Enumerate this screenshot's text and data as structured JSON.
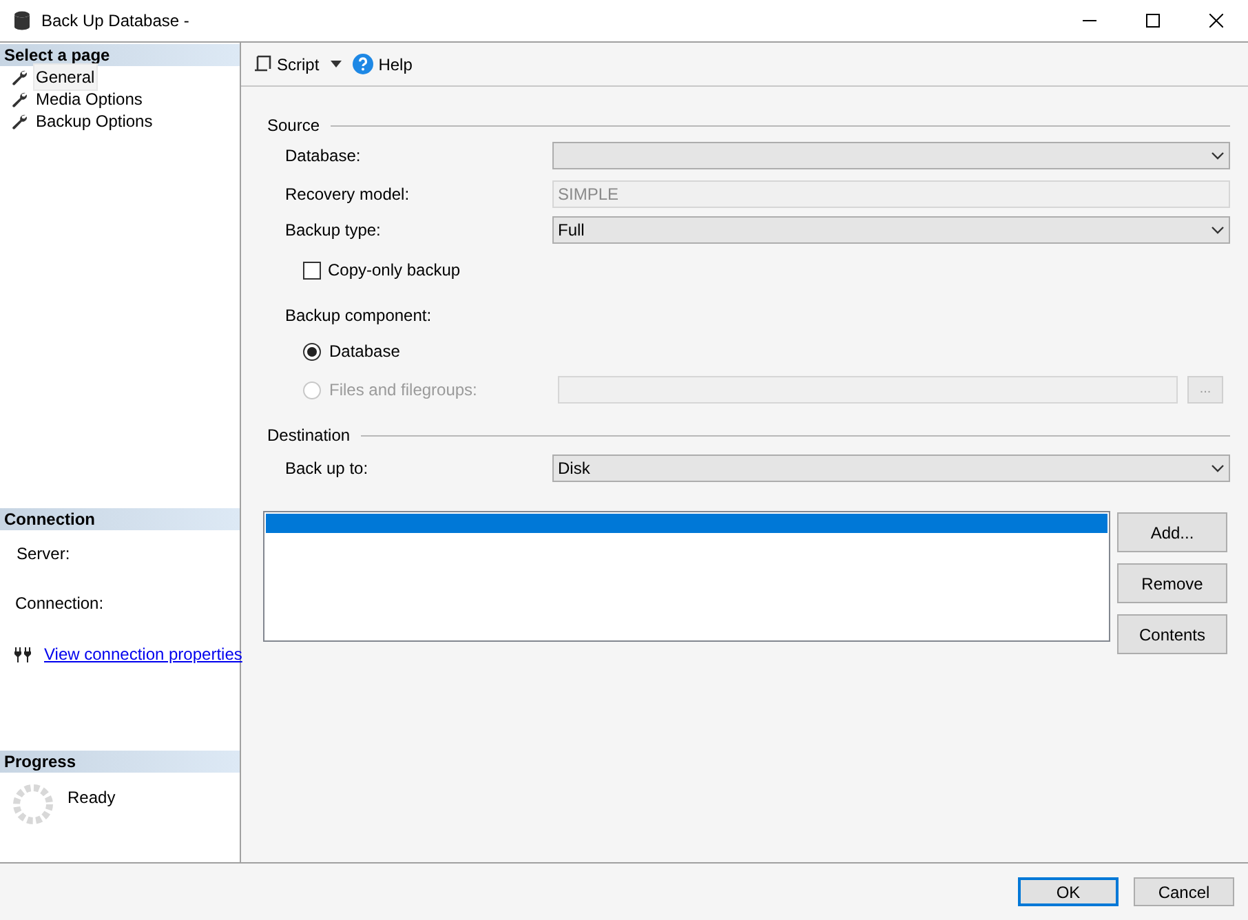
{
  "window": {
    "title": "Back Up Database -"
  },
  "sidebar": {
    "select_page": {
      "header": "Select a page",
      "items": [
        {
          "label": "General",
          "selected": true
        },
        {
          "label": "Media Options",
          "selected": false
        },
        {
          "label": "Backup Options",
          "selected": false
        }
      ]
    },
    "connection": {
      "header": "Connection",
      "fields": [
        "Server:",
        "Connection:"
      ],
      "link": "View connection properties"
    },
    "progress": {
      "header": "Progress",
      "status": "Ready"
    }
  },
  "toolbar": {
    "items": [
      {
        "kind": "script",
        "label": "Script"
      },
      {
        "kind": "help",
        "label": "Help"
      }
    ]
  },
  "source": {
    "title": "Source",
    "database": {
      "label": "Database:"
    },
    "recovery_model": {
      "label": "Recovery model:",
      "value": "SIMPLE"
    },
    "backup_type": {
      "label": "Backup type:",
      "value": "Full"
    },
    "copy_only": {
      "label": "Copy-only backup",
      "checked": false
    },
    "backup_component": {
      "label": "Backup component:",
      "options": [
        {
          "label": "Database",
          "selected": true,
          "disabled": false
        },
        {
          "label": "Files and filegroups:",
          "selected": false,
          "disabled": true
        }
      ],
      "browse_button": "..."
    }
  },
  "destination": {
    "title": "Destination",
    "back_up_to": {
      "label": "Back up to:",
      "value": "Disk"
    },
    "list": {
      "rows": [
        {
          "selected": true
        }
      ]
    },
    "buttons": [
      "Add...",
      "Remove",
      "Contents"
    ]
  },
  "dialog_buttons": [
    {
      "label": "OK",
      "default": true
    },
    {
      "label": "Cancel",
      "default": false
    }
  ]
}
